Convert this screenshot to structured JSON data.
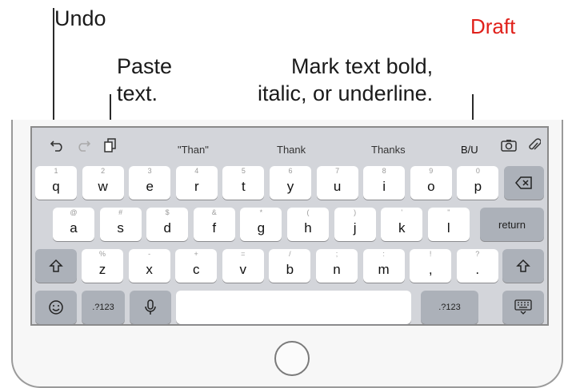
{
  "callouts": {
    "undo": "Undo",
    "paste": "Paste\ntext.",
    "format": "Mark text bold,\nitalic, or underline.",
    "draft": "Draft"
  },
  "shortcut_bar": {
    "icons": [
      "undo-icon",
      "redo-icon",
      "paste-icon",
      "camera-icon",
      "attach-icon"
    ],
    "suggestions": [
      "\"Than\"",
      "Thank",
      "Thanks"
    ],
    "biu_label": "B/U"
  },
  "keyboard": {
    "row1": [
      {
        "k": "q",
        "s": "1"
      },
      {
        "k": "w",
        "s": "2"
      },
      {
        "k": "e",
        "s": "3"
      },
      {
        "k": "r",
        "s": "4"
      },
      {
        "k": "t",
        "s": "5"
      },
      {
        "k": "y",
        "s": "6"
      },
      {
        "k": "u",
        "s": "7"
      },
      {
        "k": "i",
        "s": "8"
      },
      {
        "k": "o",
        "s": "9"
      },
      {
        "k": "p",
        "s": "0"
      }
    ],
    "row2": [
      {
        "k": "a",
        "s": "@"
      },
      {
        "k": "s",
        "s": "#"
      },
      {
        "k": "d",
        "s": "$"
      },
      {
        "k": "f",
        "s": "&"
      },
      {
        "k": "g",
        "s": "*"
      },
      {
        "k": "h",
        "s": "("
      },
      {
        "k": "j",
        "s": ")"
      },
      {
        "k": "k",
        "s": "'"
      },
      {
        "k": "l",
        "s": "\""
      }
    ],
    "row3": [
      {
        "k": "z",
        "s": "%"
      },
      {
        "k": "x",
        "s": "-"
      },
      {
        "k": "c",
        "s": "+"
      },
      {
        "k": "v",
        "s": "="
      },
      {
        "k": "b",
        "s": "/"
      },
      {
        "k": "n",
        "s": ";"
      },
      {
        "k": "m",
        "s": ":"
      }
    ],
    "punct_keys": [
      {
        "k": ",",
        "s": "!"
      },
      {
        "k": ".",
        "s": "?"
      }
    ],
    "return_label": "return",
    "numbers_label": ".?123",
    "numbers_label_right": ".?123"
  }
}
